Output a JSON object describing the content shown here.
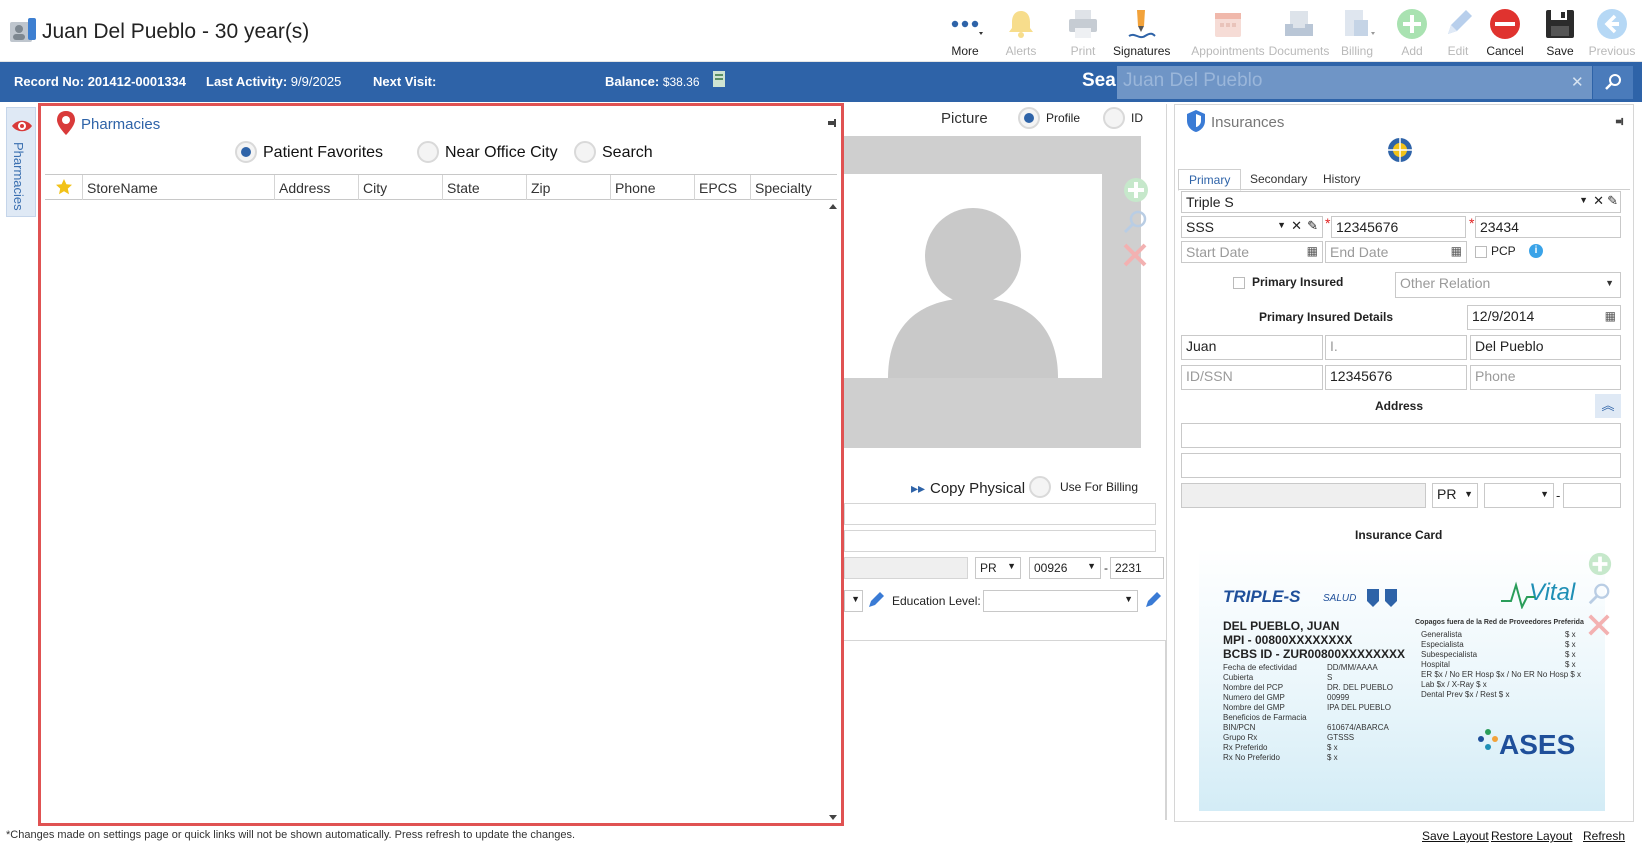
{
  "header": {
    "title": "Juan Del Pueblo - 30 year(s)"
  },
  "toolbar": {
    "more": "More",
    "alerts": "Alerts",
    "print": "Print",
    "signatures": "Signatures",
    "appointments": "Appointments",
    "documents": "Documents",
    "billing": "Billing",
    "add": "Add",
    "edit": "Edit",
    "cancel": "Cancel",
    "save": "Save",
    "previous": "Previous"
  },
  "infobar": {
    "record_label": "Record No:",
    "record_value": "201412-0001334",
    "activity_label": "Last Activity:",
    "activity_value": "9/9/2025",
    "next_visit_label": "Next Visit:",
    "balance_label": "Balance:",
    "balance_value": "$38.36",
    "search_label": "Search:",
    "search_value": "Juan Del Pueblo"
  },
  "sidebar": {
    "tab_label": "Pharmacies"
  },
  "pharmacies": {
    "title": "Pharmacies",
    "options": [
      "Patient Favorites",
      "Near Office City",
      "Search"
    ],
    "selected": "Patient Favorites",
    "columns": [
      "StoreName",
      "Address",
      "City",
      "State",
      "Zip",
      "Phone",
      "EPCS",
      "Specialty"
    ]
  },
  "middle": {
    "picture_label": "Picture",
    "profile_label": "Profile",
    "id_label": "ID",
    "copy_physical": "Copy Physical",
    "use_for_billing": "Use For Billing",
    "state": "PR",
    "zip": "00926",
    "zip_ext": "2231",
    "education_label": "Education Level:"
  },
  "insurances": {
    "title": "Insurances",
    "tabs": [
      "Primary",
      "Secondary",
      "History"
    ],
    "active_tab": "Primary",
    "plan": "Triple S",
    "sub_plan": "SSS",
    "member_id": "12345676",
    "group": "23434",
    "start_date_ph": "Start Date",
    "end_date_ph": "End Date",
    "pcp_label": "PCP",
    "primary_insured_label": "Primary Insured",
    "other_relation_ph": "Other Relation",
    "details_label": "Primary Insured Details",
    "dob": "12/9/2014",
    "first_name": "Juan",
    "middle_initial_ph": "I.",
    "last_name": "Del Pueblo",
    "id_ssn_ph": "ID/SSN",
    "insured_id": "12345676",
    "phone_ph": "Phone",
    "address_label": "Address",
    "addr_state": "PR",
    "card_label": "Insurance Card",
    "card": {
      "brand_left": "TRIPLE-S",
      "brand_left_sub": "SALUD",
      "brand_right": "Vital",
      "name": "DEL PUEBLO, JUAN",
      "mpi": "MPI - 00800XXXXXXXX",
      "bcbs": "BCBS ID - ZUR00800XXXXXXXX",
      "left_rows": [
        [
          "Fecha de efectividad",
          "DD/MM/AAAA"
        ],
        [
          "Cubierta",
          "S"
        ],
        [
          "Nombre del PCP",
          "DR. DEL PUEBLO"
        ],
        [
          "Numero del GMP",
          "00999"
        ],
        [
          "Nombre del GMP",
          "IPA DEL PUEBLO"
        ],
        [
          "Beneficios de Farmacia",
          ""
        ],
        [
          "BIN/PCN",
          "610674/ABARCA"
        ],
        [
          "Grupo Rx",
          "GTSSS"
        ],
        [
          "Rx Preferido",
          "$ x"
        ],
        [
          "Rx No Preferido",
          "$ x"
        ]
      ],
      "right_title": "Copagos fuera de la Red de Proveedores Preferida",
      "right_rows": [
        [
          "Generalista",
          "$ x"
        ],
        [
          "Especialista",
          "$ x"
        ],
        [
          "Subespecialista",
          "$ x"
        ],
        [
          "Hospital",
          "$ x"
        ],
        [
          "ER $x / No ER Hosp $x / No ER No Hosp $ x",
          ""
        ],
        [
          "Lab $x / X-Ray $ x",
          ""
        ],
        [
          "Dental Prev $x / Rest $ x",
          ""
        ]
      ],
      "ases": "ASES"
    }
  },
  "footer": {
    "note": "*Changes made on settings page or quick links will not be shown automatically. Press refresh to update the changes.",
    "save_layout": "Save Layout",
    "restore_layout": "Restore Layout",
    "refresh": "Refresh"
  },
  "colors": {
    "brand_blue": "#2e63a8",
    "highlight_red": "#e05252",
    "cancel_red": "#e0332f",
    "add_green": "#7ccf87"
  }
}
